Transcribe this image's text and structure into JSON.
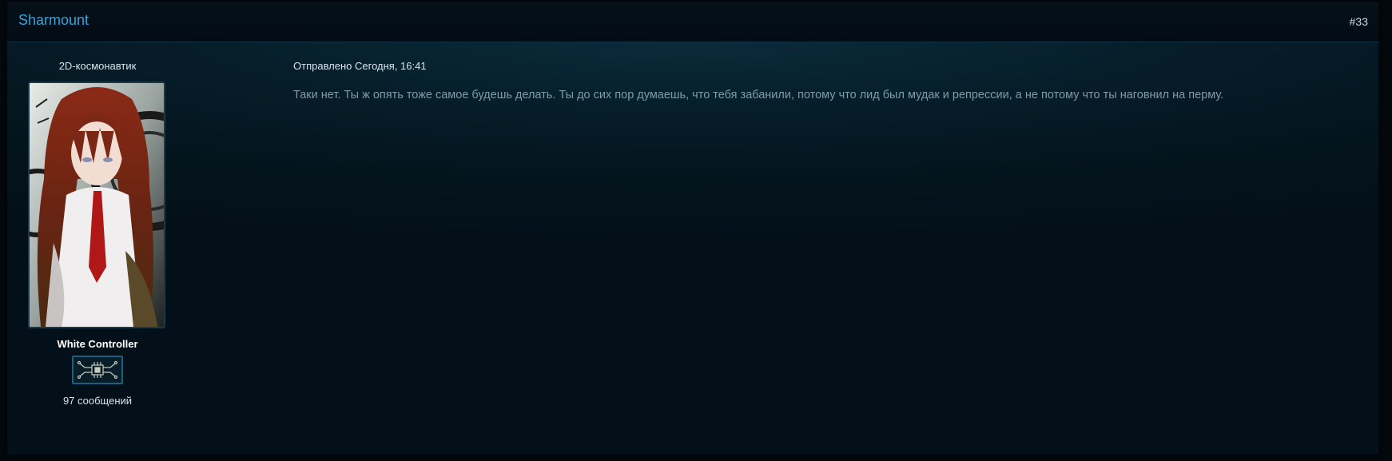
{
  "post": {
    "author": "Sharmount",
    "number": "#33",
    "date": "Отправлено Сегодня, 16:41",
    "text": "Таки нет. Ты ж опять тоже самое будешь делать. Ты до сих пор думаешь, что тебя забанили, потому что лид был мудак и репрессии, а не потому что ты наговнил на перму."
  },
  "profile": {
    "user_title": "2D-космонавтик",
    "group": "White Controller",
    "rank_icon": "circuit-chip-icon",
    "post_count": "97 сообщений"
  },
  "colors": {
    "author_link": "#34a4d9",
    "background": "#04141d",
    "body_text": "#7f9aaa",
    "badge_border": "#1d5f7c"
  }
}
